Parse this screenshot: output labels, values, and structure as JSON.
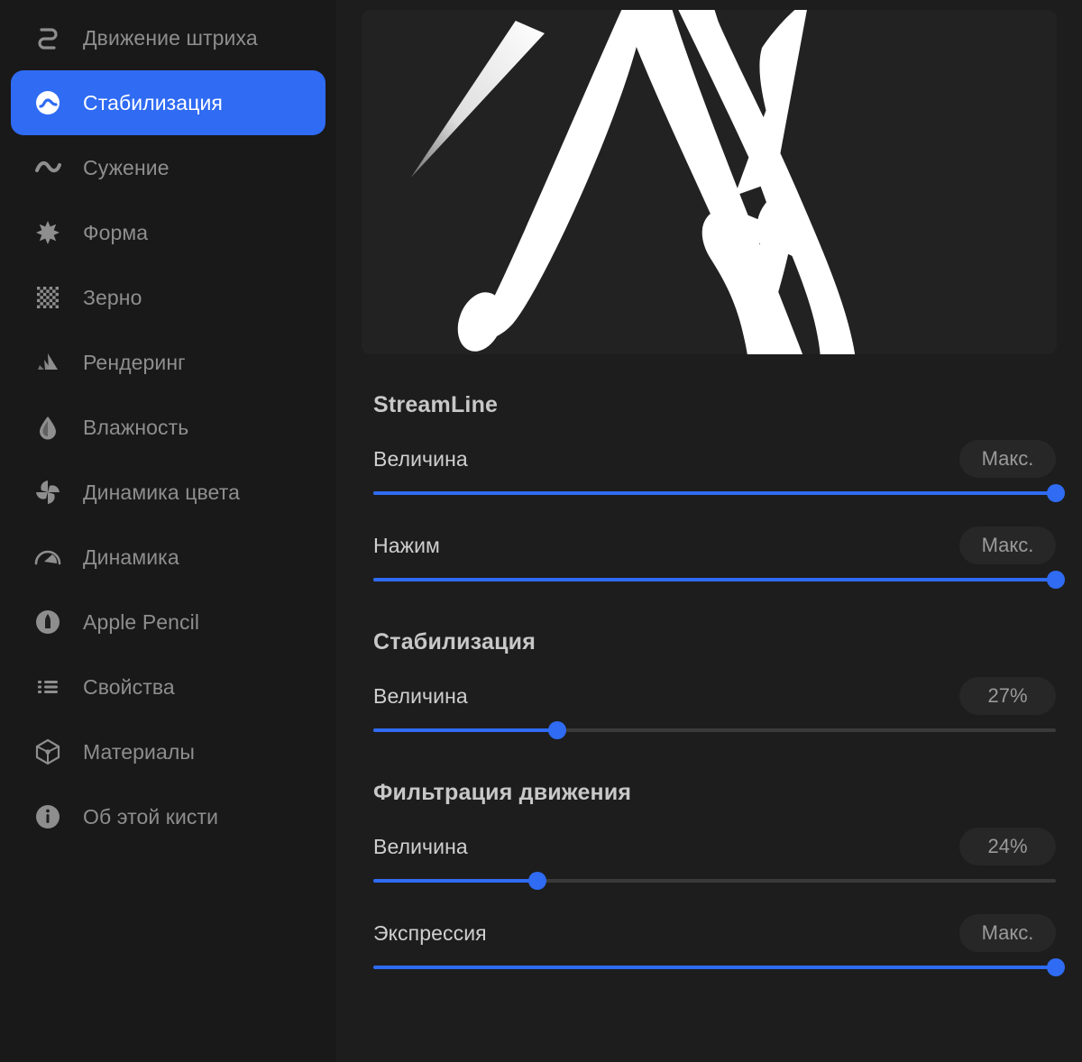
{
  "theme": {
    "accent": "#2f6bf3",
    "sidebar_bg": "#191919",
    "panel_bg": "#1d1d1d",
    "preview_bg": "#222222",
    "label_color": "#8e8e8e",
    "track_bg": "#3a3a3a",
    "badge_bg": "#272727"
  },
  "sidebar": {
    "items": [
      {
        "label": "Движение штриха",
        "icon": "stroke-path-icon",
        "active": false
      },
      {
        "label": "Стабилизация",
        "icon": "stabilization-icon",
        "active": true
      },
      {
        "label": "Сужение",
        "icon": "taper-icon",
        "active": false
      },
      {
        "label": "Форма",
        "icon": "shape-star-icon",
        "active": false
      },
      {
        "label": "Зерно",
        "icon": "grain-checker-icon",
        "active": false
      },
      {
        "label": "Рендеринг",
        "icon": "rendering-icon",
        "active": false
      },
      {
        "label": "Влажность",
        "icon": "wet-mix-droplet-icon",
        "active": false
      },
      {
        "label": "Динамика цвета",
        "icon": "color-dynamics-pinwheel-icon",
        "active": false
      },
      {
        "label": "Динамика",
        "icon": "dynamics-speedometer-icon",
        "active": false
      },
      {
        "label": "Apple Pencil",
        "icon": "apple-pencil-icon",
        "active": false
      },
      {
        "label": "Свойства",
        "icon": "properties-list-icon",
        "active": false
      },
      {
        "label": "Материалы",
        "icon": "materials-cube-icon",
        "active": false
      },
      {
        "label": "Об этой кисти",
        "icon": "about-info-icon",
        "active": false
      }
    ]
  },
  "preview": {
    "name": "brush-stroke-preview"
  },
  "sections": [
    {
      "title": "StreamLine",
      "sliders": [
        {
          "name": "Величина",
          "badge": "Макс.",
          "percent": 100
        },
        {
          "name": "Нажим",
          "badge": "Макс.",
          "percent": 100
        }
      ]
    },
    {
      "title": "Стабилизация",
      "sliders": [
        {
          "name": "Величина",
          "badge": "27%",
          "percent": 27
        }
      ]
    },
    {
      "title": "Фильтрация движения",
      "sliders": [
        {
          "name": "Величина",
          "badge": "24%",
          "percent": 24
        },
        {
          "name": "Экспрессия",
          "badge": "Макс.",
          "percent": 100
        }
      ]
    }
  ]
}
